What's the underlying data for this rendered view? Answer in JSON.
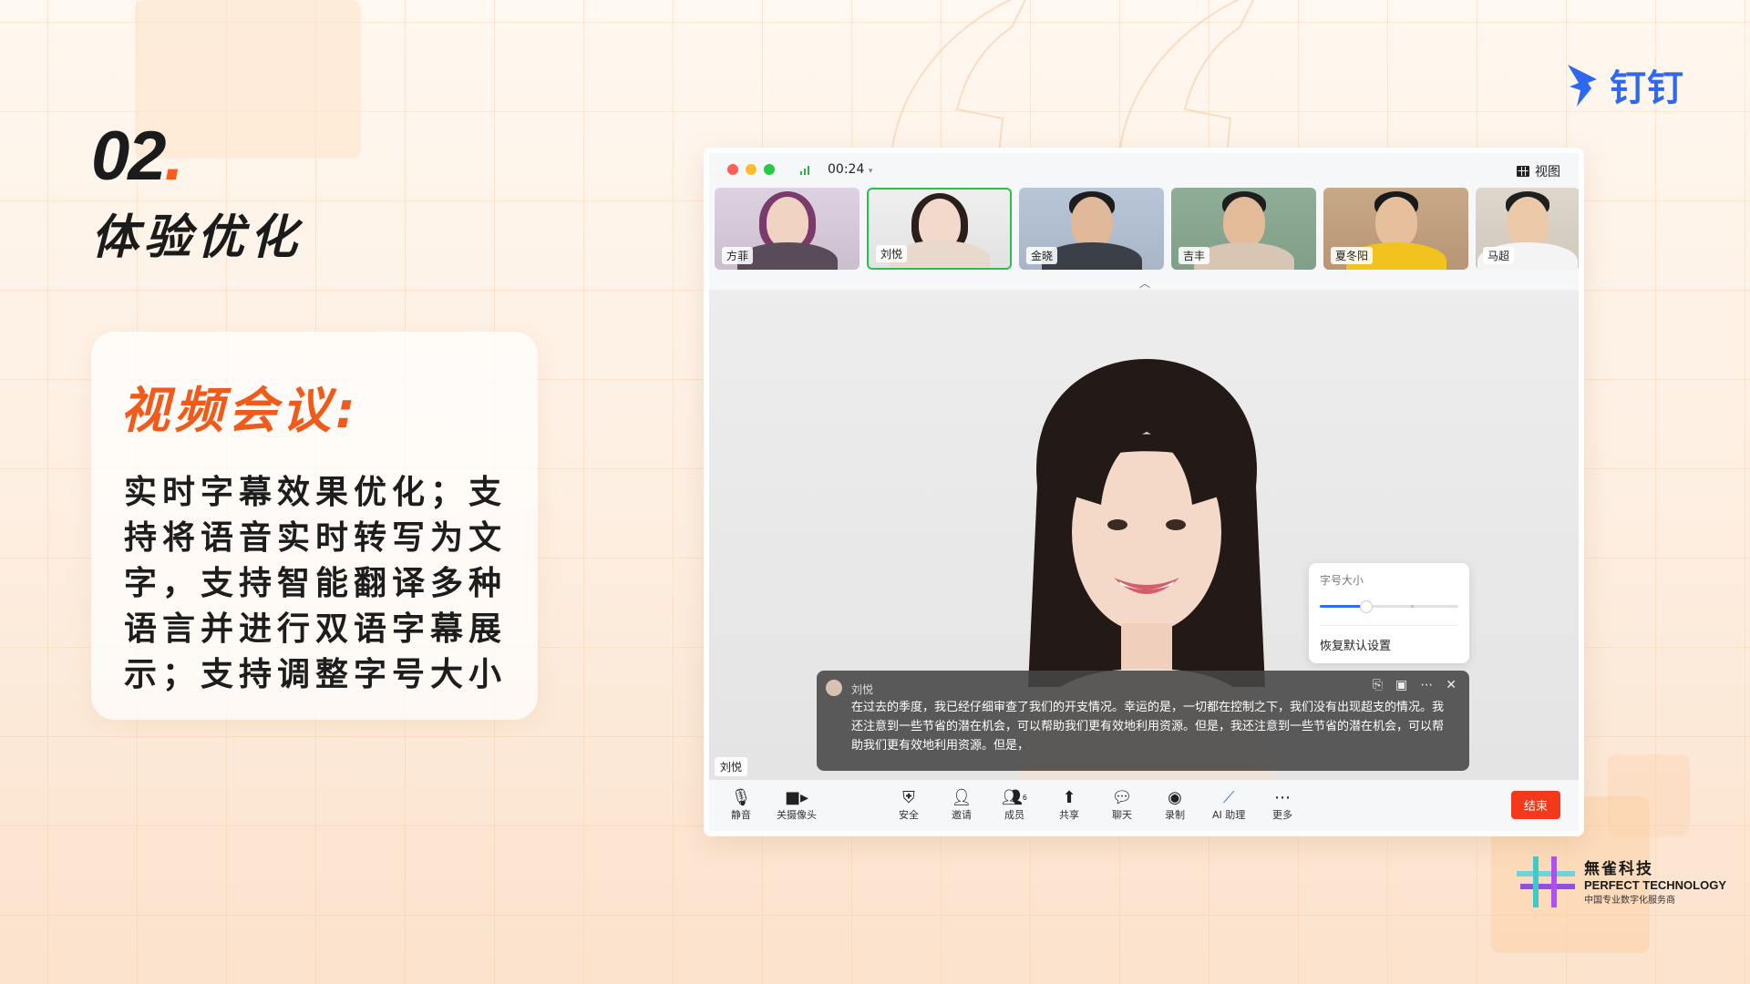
{
  "brand": {
    "name": "钉钉",
    "accent": "#2d68f0"
  },
  "section": {
    "number": "02",
    "dot": ".",
    "title": "体验优化"
  },
  "card": {
    "title": "视频会议:",
    "lines": [
      "实时字幕效果优化；支",
      "持将语音实时转写为文",
      "字，支持智能翻译多种",
      "语言并进行双语字幕展",
      "示；支持调整字号大小"
    ]
  },
  "meeting": {
    "timer": "00:24",
    "view_label": "视图",
    "participants": [
      {
        "name": "方菲"
      },
      {
        "name": "刘悦"
      },
      {
        "name": "金晓"
      },
      {
        "name": "吉丰"
      },
      {
        "name": "夏冬阳"
      },
      {
        "name": "马超"
      }
    ],
    "speaker_label": "刘悦",
    "font_popup": {
      "label": "字号大小",
      "reset": "恢复默认设置",
      "level": 0.33
    },
    "caption": {
      "speaker": "刘悦",
      "text": "在过去的季度，我已经仔细审查了我们的开支情况。幸运的是，一切都在控制之下，我们没有出现超支的情况。我还注意到一些节省的潜在机会，可以帮助我们更有效地利用资源。但是，我还注意到一些节省的潜在机会，可以帮助我们更有效地利用资源。但是，"
    },
    "toolbar": {
      "mute": "静音",
      "camera": "关摄像头",
      "security": "安全",
      "invite": "邀请",
      "members": "成员",
      "members_count": "6",
      "share": "共享",
      "chat": "聊天",
      "record": "录制",
      "ai": "AI 助理",
      "more": "更多",
      "end": "结束"
    }
  },
  "company": {
    "name_cn": "無雀科技",
    "name_en": "PERFECT TECHNOLOGY",
    "tagline": "中国专业数字化服务商"
  },
  "colors": {
    "orange": "#ff5a1f",
    "end_red": "#f3391c",
    "active_green": "#28c24a"
  }
}
